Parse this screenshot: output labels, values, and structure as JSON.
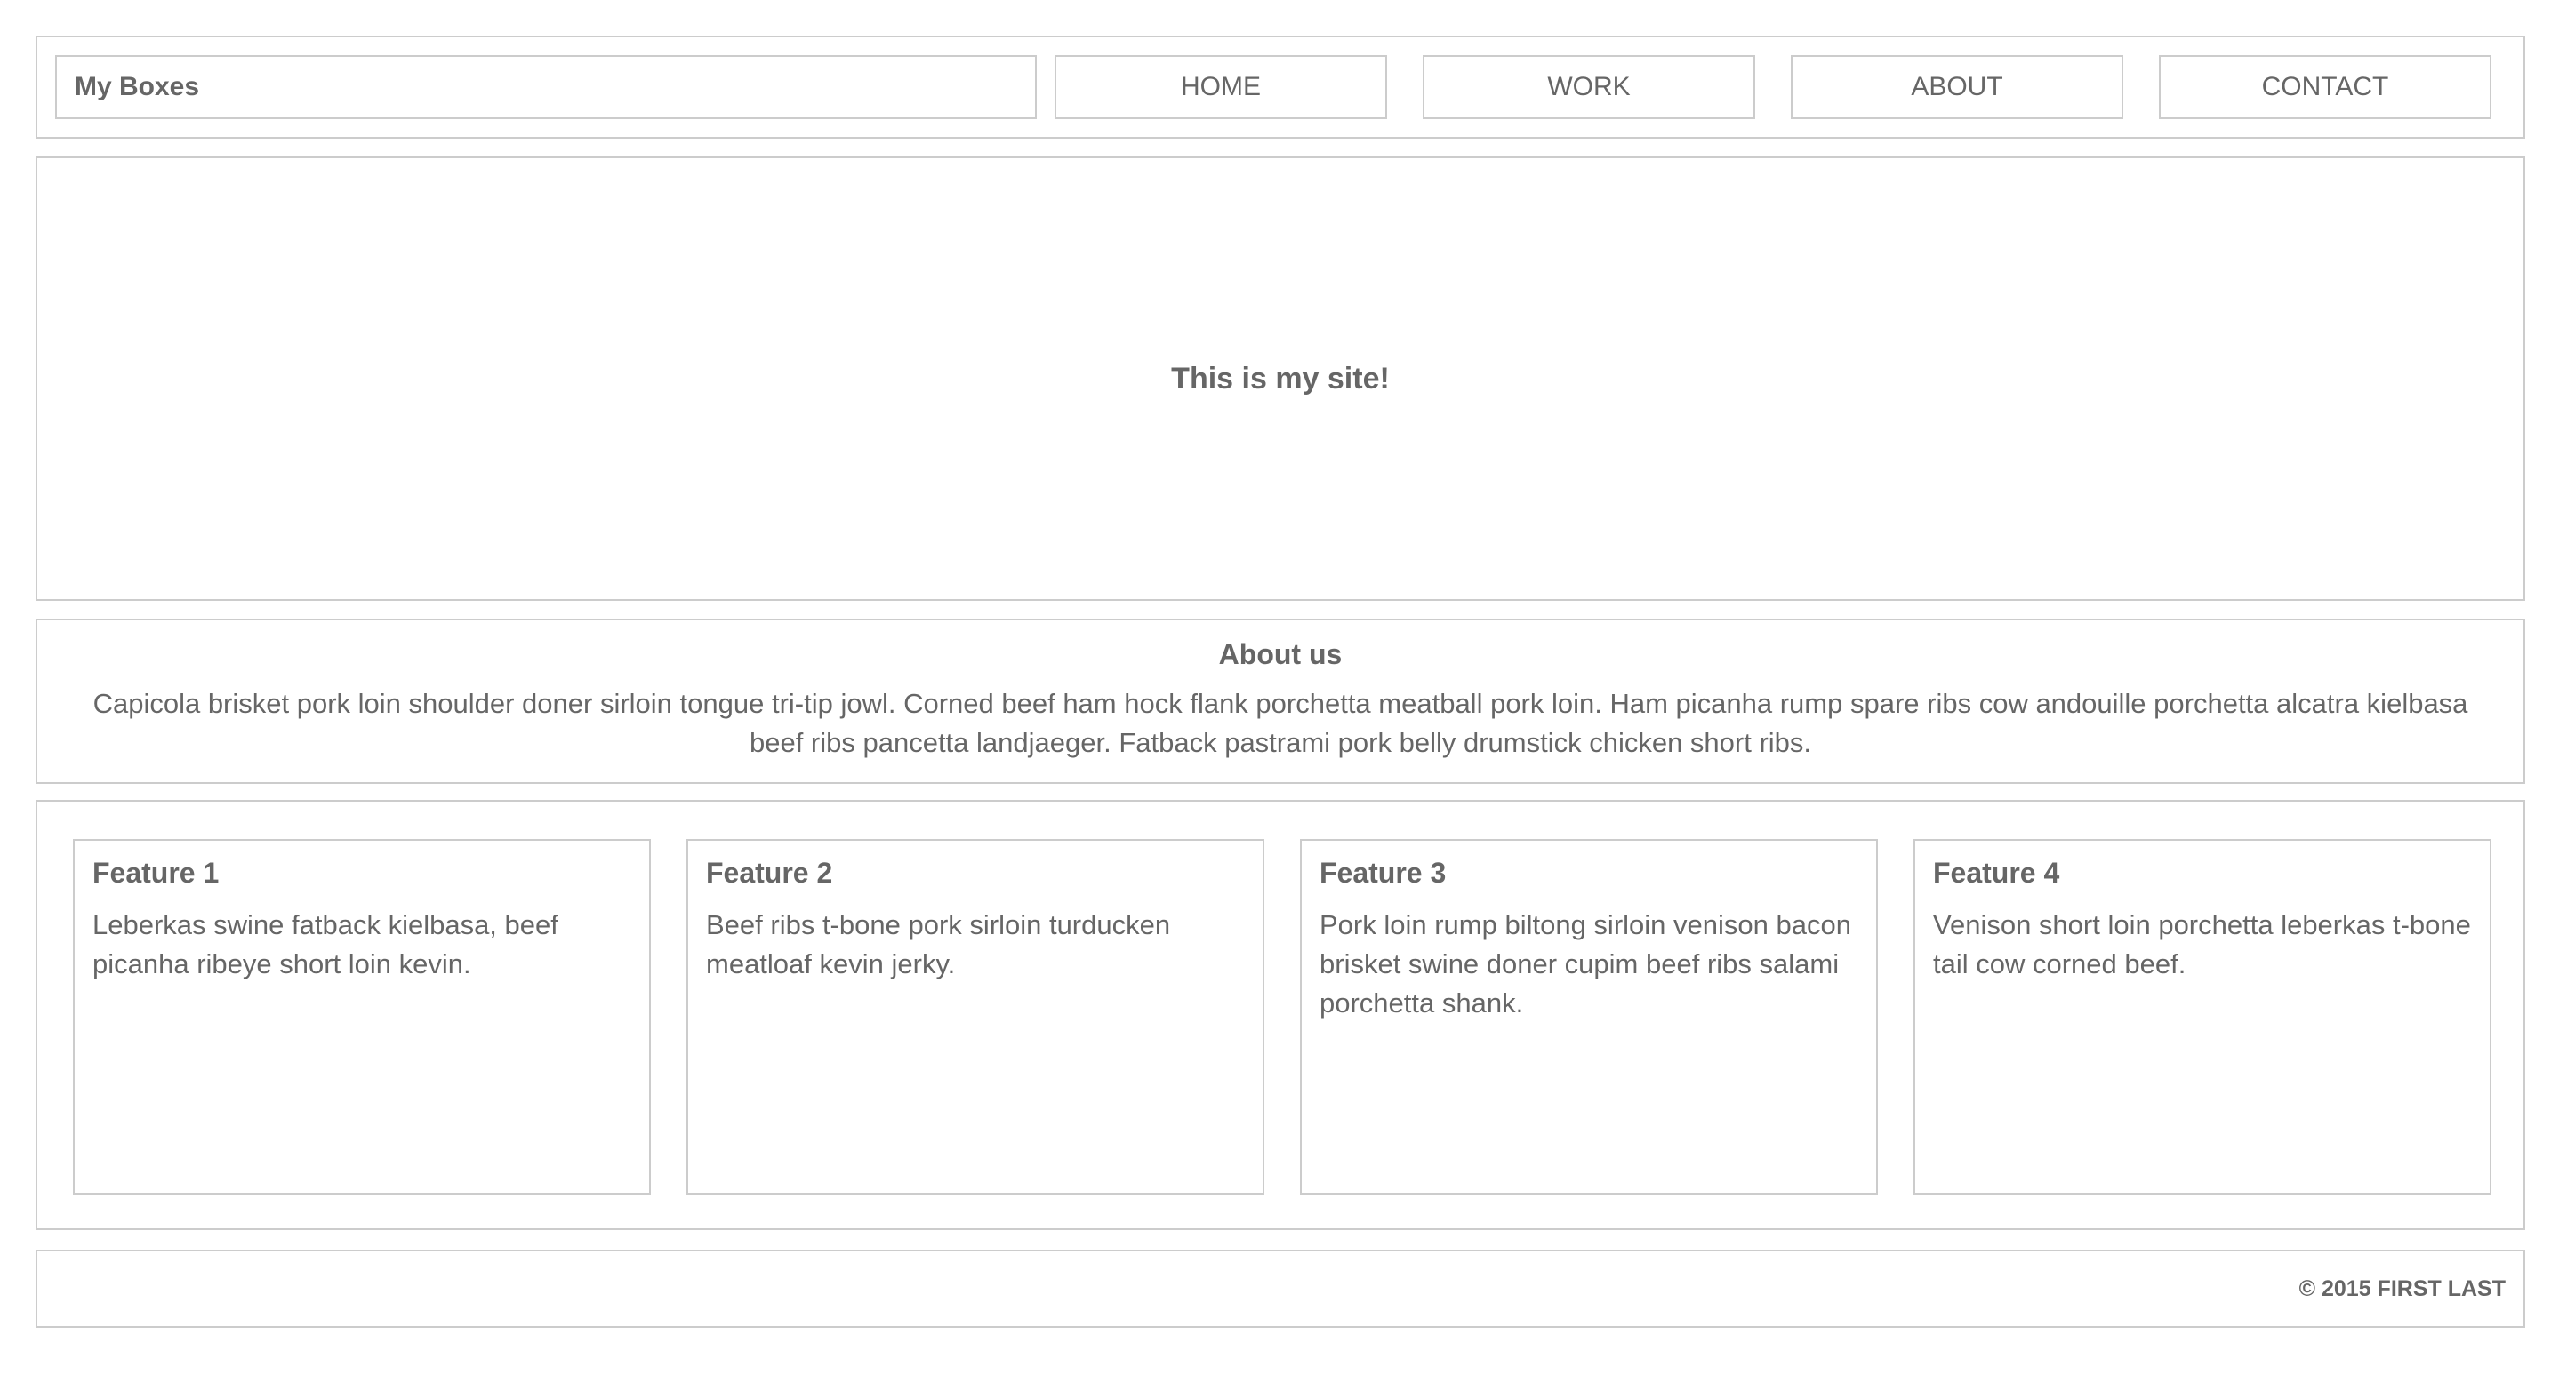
{
  "header": {
    "logo": "My Boxes",
    "nav": {
      "home": "HOME",
      "work": "WORK",
      "about": "ABOUT",
      "contact": "CONTACT"
    }
  },
  "hero": {
    "text": "This is my site!"
  },
  "about": {
    "title": "About us",
    "body": "Capicola brisket pork loin shoulder doner sirloin tongue tri-tip jowl. Corned beef ham hock flank porchetta meatball pork loin. Ham picanha rump spare ribs cow andouille porchetta alcatra kielbasa beef ribs pancetta landjaeger. Fatback pastrami pork belly drumstick chicken short ribs."
  },
  "features": [
    {
      "title": "Feature 1",
      "text": "Leberkas swine fatback kielbasa, beef picanha ribeye short loin kevin."
    },
    {
      "title": "Feature 2",
      "text": "Beef ribs t-bone pork sirloin turducken meatloaf kevin jerky."
    },
    {
      "title": "Feature 3",
      "text": "Pork loin rump biltong sirloin venison bacon brisket swine doner cupim beef ribs salami porchetta shank."
    },
    {
      "title": "Feature 4",
      "text": "Venison short loin porchetta leberkas t-bone tail cow corned beef."
    }
  ],
  "footer": {
    "copyright": "© 2015 FIRST LAST"
  },
  "colors": {
    "border": "#cccccc",
    "text": "#666666",
    "background": "#ffffff"
  }
}
